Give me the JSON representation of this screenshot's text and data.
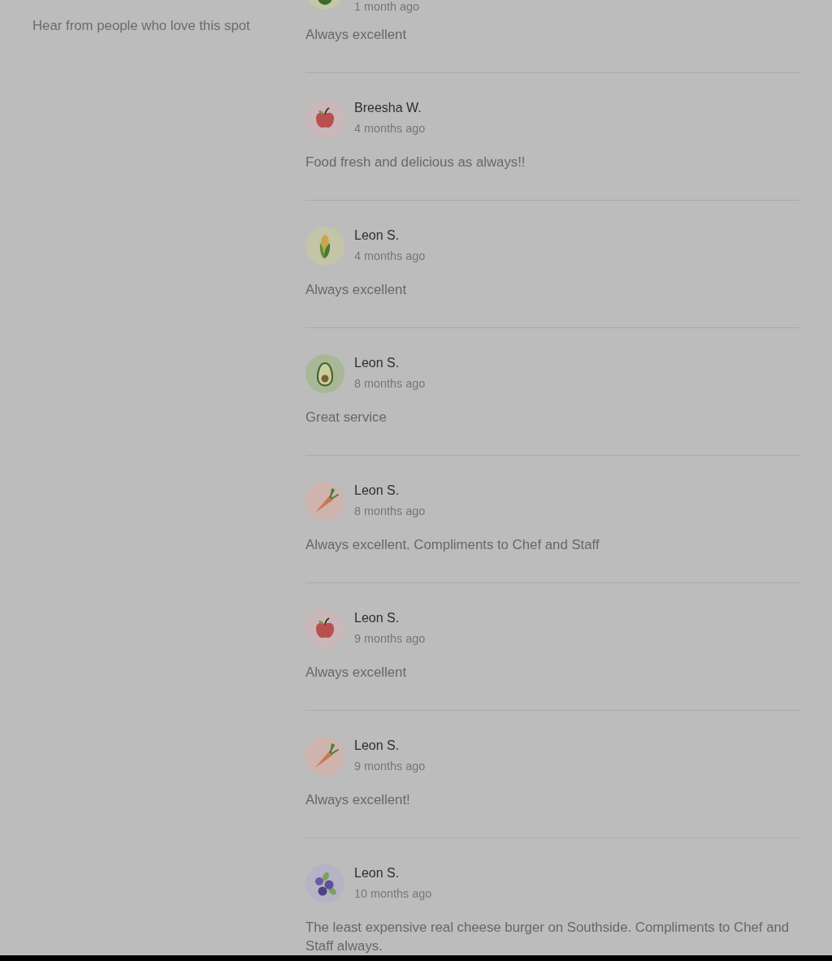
{
  "sidebar": {
    "subtitle": "Hear from people who love this spot"
  },
  "reviews": [
    {
      "cropped": true,
      "avatar": {
        "kind": "lime"
      },
      "time": "1 month ago",
      "text": "Always excellent"
    },
    {
      "cropped": false,
      "avatar": {
        "kind": "apple"
      },
      "name": "Breesha W.",
      "time": "4 months ago",
      "text": "Food fresh and delicious as always!!"
    },
    {
      "cropped": false,
      "avatar": {
        "kind": "corn"
      },
      "name": "Leon S.",
      "time": "4 months ago",
      "text": "Always excellent"
    },
    {
      "cropped": false,
      "avatar": {
        "kind": "avocado"
      },
      "name": "Leon S.",
      "time": "8 months ago",
      "text": "Great service"
    },
    {
      "cropped": false,
      "avatar": {
        "kind": "carrot"
      },
      "name": "Leon S.",
      "time": "8 months ago",
      "text": "Always excellent. Compliments to Chef and Staff"
    },
    {
      "cropped": false,
      "avatar": {
        "kind": "apple"
      },
      "name": "Leon S.",
      "time": "9 months ago",
      "text": "Always excellent"
    },
    {
      "cropped": false,
      "avatar": {
        "kind": "carrot"
      },
      "name": "Leon S.",
      "time": "9 months ago",
      "text": "Always excellent!"
    },
    {
      "cropped": false,
      "avatar": {
        "kind": "blueberry"
      },
      "name": "Leon S.",
      "time": "10 months ago",
      "text": "The least expensive real cheese burger on Southside. Compliments to Chef and Staff always."
    }
  ]
}
